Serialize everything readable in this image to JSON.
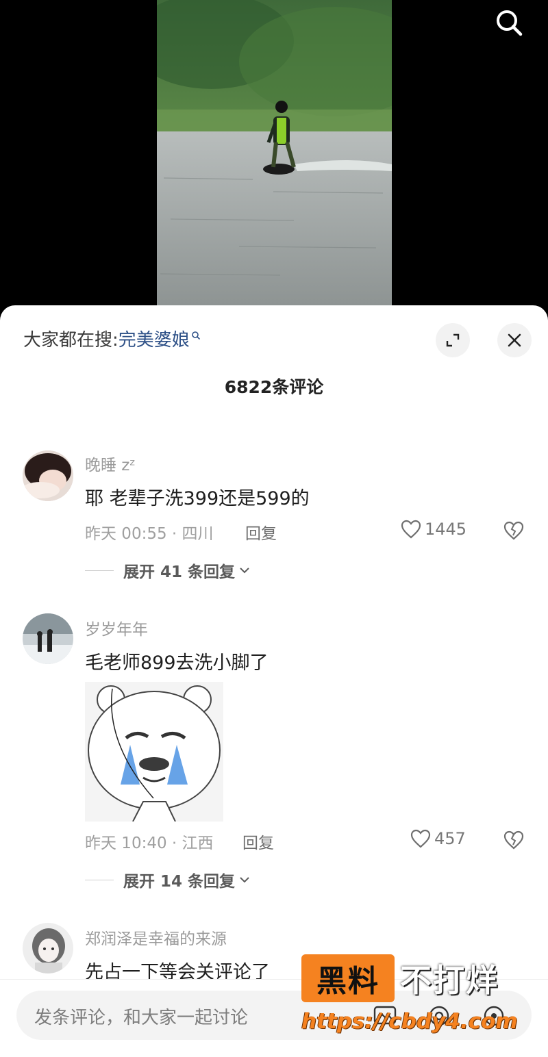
{
  "hot_search": {
    "prefix": "大家都在搜:",
    "term": "完美婆娘"
  },
  "comment_count": "6822条评论",
  "comments": [
    {
      "username": "晚睡 zᶻ",
      "text": "耶 老辈子洗399还是599的",
      "meta": "昨天 00:55 · 四川",
      "reply_label": "回复",
      "likes": "1445",
      "expand_label": "展开 41 条回复"
    },
    {
      "username": "岁岁年年",
      "text": "毛老师899去洗小脚了",
      "meta": "昨天 10:40 · 江西",
      "reply_label": "回复",
      "likes": "457",
      "expand_label": "展开 14 条回复",
      "sticker_icon": "crying-bear-sticker"
    },
    {
      "username": "郑润泽是幸福的来源",
      "text": "先占一下等会关评论了"
    }
  ],
  "input": {
    "placeholder": "发条评论，和大家一起讨论"
  },
  "watermark": {
    "badge": "黑料",
    "right": "不打烊",
    "url": "https://cbdy4.com"
  },
  "icons": {
    "search": "search-icon",
    "expand": "expand-icon",
    "close": "close-icon",
    "like": "heart-icon",
    "dislike": "broken-heart-icon",
    "chevron": "chevron-down-icon"
  },
  "colors": {
    "accent_link": "#2c4f86",
    "watermark_orange": "#f58220"
  }
}
